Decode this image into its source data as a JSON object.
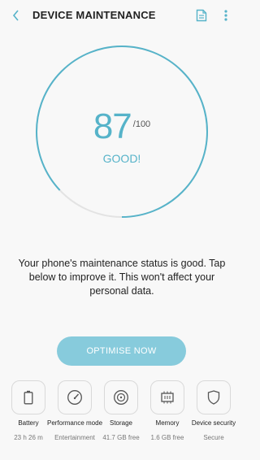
{
  "header": {
    "title": "DEVICE MAINTENANCE",
    "back_icon": "chevron-left-icon",
    "doc_icon": "document-icon",
    "more_icon": "more-vert-icon"
  },
  "gauge": {
    "score": "87",
    "max": "/100",
    "status": "GOOD!",
    "fraction": 0.87
  },
  "message": "Your phone's maintenance status is good. Tap below to improve it. This won't affect your personal data.",
  "action": {
    "label": "OPTIMISE NOW"
  },
  "cards": [
    {
      "label": "Battery",
      "value": "23 h 26 m",
      "icon": "battery-icon"
    },
    {
      "label": "Performance mode",
      "value": "Entertainment",
      "icon": "speedometer-icon"
    },
    {
      "label": "Storage",
      "value": "41.7 GB free",
      "icon": "storage-icon"
    },
    {
      "label": "Memory",
      "value": "1.6 GB free",
      "icon": "memory-chip-icon"
    },
    {
      "label": "Device security",
      "value": "Secure",
      "icon": "shield-icon"
    }
  ],
  "colors": {
    "accent": "#56b3c9",
    "track": "#e3e3e3",
    "button": "#87cbdc"
  }
}
